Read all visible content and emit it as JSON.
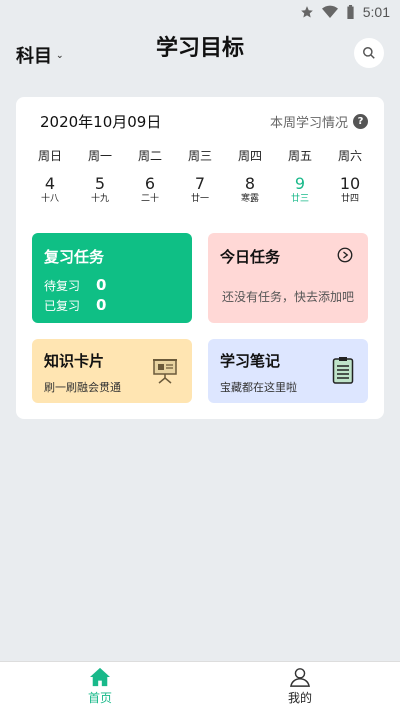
{
  "status_bar": {
    "time": "5:01"
  },
  "header": {
    "subject": "科目",
    "title": "学习目标"
  },
  "overview": {
    "date": "2020年10月09日",
    "week_link": "本周学习情况",
    "days": [
      {
        "weekday": "周日",
        "day": "4",
        "lunar": "十八"
      },
      {
        "weekday": "周一",
        "day": "5",
        "lunar": "十九"
      },
      {
        "weekday": "周二",
        "day": "6",
        "lunar": "二十"
      },
      {
        "weekday": "周三",
        "day": "7",
        "lunar": "廿一"
      },
      {
        "weekday": "周四",
        "day": "8",
        "lunar": "寒露"
      },
      {
        "weekday": "周五",
        "day": "9",
        "lunar": "廿三"
      },
      {
        "weekday": "周六",
        "day": "10",
        "lunar": "廿四"
      }
    ],
    "active_day_index": 5,
    "accent_color": "#19b98a"
  },
  "review": {
    "title": "复习任务",
    "pending_label": "待复习",
    "pending_value": "0",
    "done_label": "已复习",
    "done_value": "0",
    "color": "#0fbf85"
  },
  "today": {
    "title": "今日任务",
    "empty_text": "还没有任务，快去添加吧",
    "color": "#ffd8d6"
  },
  "flashcards": {
    "title": "知识卡片",
    "subtitle": "刷一刷融会贯通",
    "color": "#ffe5b2"
  },
  "notes": {
    "title": "学习笔记",
    "subtitle": "宝藏都在这里啦",
    "color": "#dde6ff"
  },
  "nav": [
    {
      "label": "首页",
      "icon": "home-icon",
      "active": true
    },
    {
      "label": "我的",
      "icon": "profile-icon",
      "active": false
    }
  ]
}
